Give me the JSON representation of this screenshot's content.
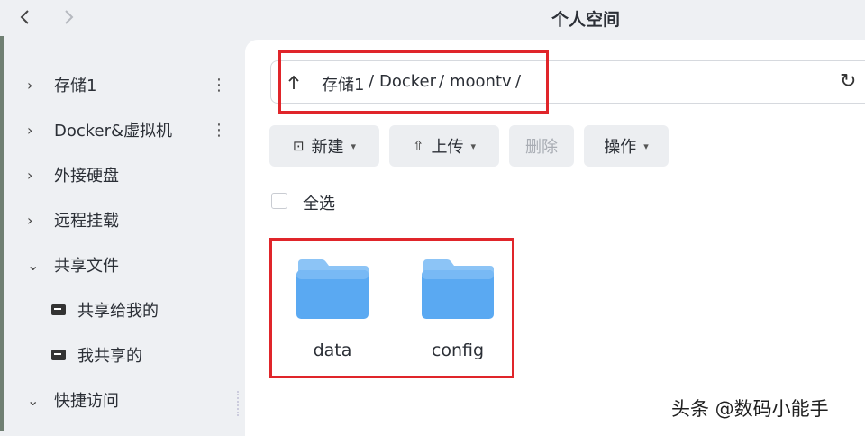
{
  "window": {
    "title": "个人空间",
    "back_icon": "chevron-left-icon",
    "forward_icon": "chevron-right-icon"
  },
  "sidebar": {
    "items": [
      {
        "label": "存储1",
        "expanded": false,
        "has_more": true
      },
      {
        "label": "Docker&虚拟机",
        "expanded": false,
        "has_more": true
      },
      {
        "label": "外接硬盘",
        "expanded": false
      },
      {
        "label": "远程挂载",
        "expanded": false
      },
      {
        "label": "共享文件",
        "expanded": true
      },
      {
        "label": "共享给我的",
        "sub": true
      },
      {
        "label": "我共享的",
        "sub": true
      },
      {
        "label": "快捷访问",
        "expanded": true
      }
    ]
  },
  "path": {
    "segments": [
      "存储1",
      "Docker",
      "moontv"
    ],
    "separator": "/"
  },
  "toolbar": {
    "new_label": "新建",
    "upload_label": "上传",
    "delete_label": "删除",
    "action_label": "操作"
  },
  "select_all_label": "全选",
  "files": [
    {
      "name": "data",
      "type": "folder"
    },
    {
      "name": "config",
      "type": "folder"
    }
  ],
  "watermark": "头条 @数码小能手",
  "colors": {
    "folder": "#5aa9f2",
    "highlight": "#e0252a",
    "background": "#eef0f3"
  }
}
